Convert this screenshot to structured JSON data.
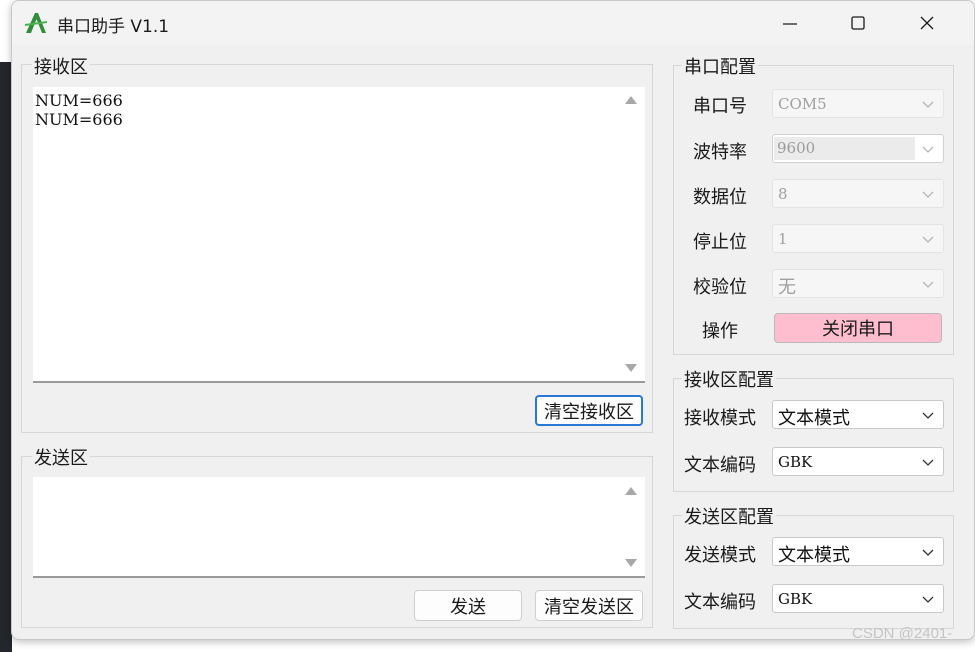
{
  "window": {
    "title": "串口助手 V1.1",
    "accent_color": "#2a78d6",
    "button_pink": "#ffbdd0"
  },
  "receive": {
    "group_title": "接收区",
    "content": "NUM=666\nNUM=666",
    "clear_button": "清空接收区"
  },
  "send": {
    "group_title": "发送区",
    "content": "",
    "send_button": "发送",
    "clear_button": "清空发送区"
  },
  "port_config": {
    "group_title": "串口配置",
    "port_label": "串口号",
    "port_value": "COM5",
    "baud_label": "波特率",
    "baud_value": "9600",
    "databits_label": "数据位",
    "databits_value": "8",
    "stopbits_label": "停止位",
    "stopbits_value": "1",
    "parity_label": "校验位",
    "parity_value": "无",
    "operation_label": "操作",
    "operation_button": "关闭串口"
  },
  "receive_config": {
    "group_title": "接收区配置",
    "mode_label": "接收模式",
    "mode_value": "文本模式",
    "encoding_label": "文本编码",
    "encoding_value": "GBK"
  },
  "send_config": {
    "group_title": "发送区配置",
    "mode_label": "发送模式",
    "mode_value": "文本模式",
    "encoding_label": "文本编码",
    "encoding_value": "GBK"
  },
  "watermark": "CSDN @2401-"
}
